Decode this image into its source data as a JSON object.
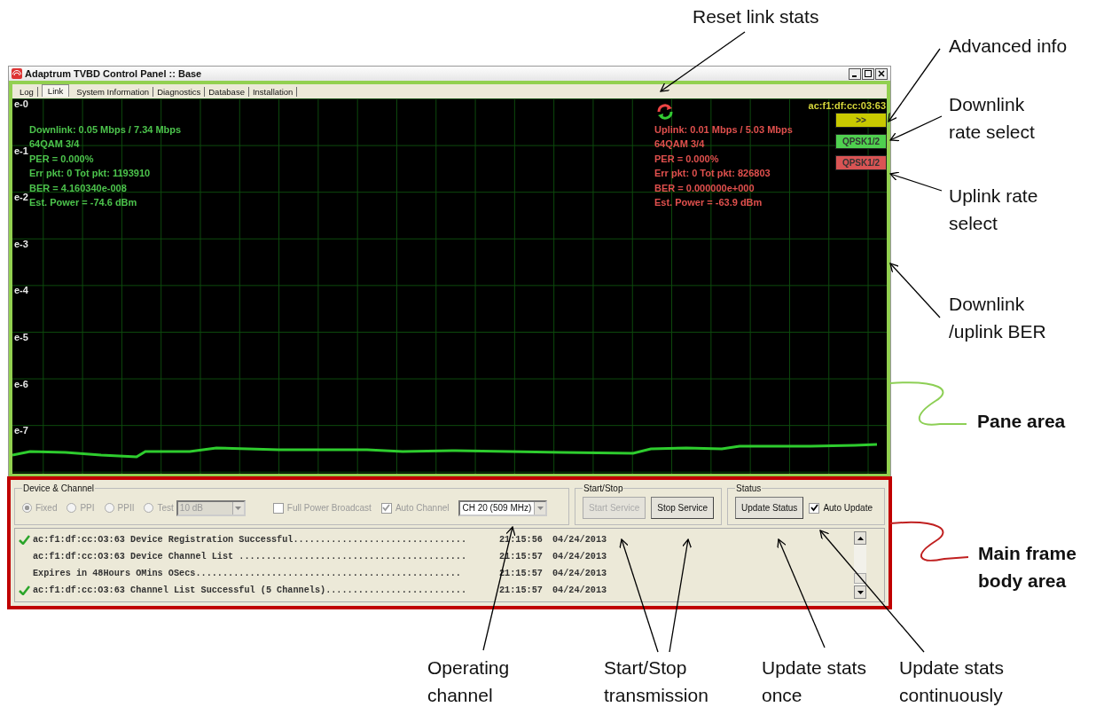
{
  "window": {
    "title": "Adaptrum TVBD Control Panel :: Base"
  },
  "tabs": [
    {
      "label": "Log",
      "selected": false
    },
    {
      "label": "Link",
      "selected": true
    },
    {
      "label": "System Information",
      "selected": false
    },
    {
      "label": "Diagnostics",
      "selected": false
    },
    {
      "label": "Database",
      "selected": false
    },
    {
      "label": "Installation",
      "selected": false
    }
  ],
  "plot": {
    "y_labels": [
      "e-0",
      "e-1",
      "e-2",
      "e-3",
      "e-4",
      "e-5",
      "e-6",
      "e-7"
    ],
    "device_id": "ac:f1:df:cc:03:63",
    "downlink_stats": [
      "Downlink:  0.05 Mbps / 7.34 Mbps",
      "64QAM  3/4",
      "PER = 0.000%",
      "Err pkt: 0 Tot pkt: 1193910",
      "BER = 4.160340e-008",
      "Est. Power = -74.6 dBm"
    ],
    "uplink_stats": [
      "Uplink: 0.01 Mbps / 5.03 Mbps",
      "64QAM  3/4",
      "PER = 0.000%",
      "Err pkt: 0 Tot pkt: 826803",
      "BER = 0.000000e+000",
      "Est. Power = -63.9 dBm"
    ],
    "advanced_button": ">>",
    "downlink_rate": "QPSK1/2",
    "uplink_rate": "QPSK1/2"
  },
  "device_channel": {
    "title": "Device & Channel",
    "modes": [
      {
        "label": "Fixed",
        "selected": true
      },
      {
        "label": "PPI",
        "selected": false
      },
      {
        "label": "PPII",
        "selected": false
      },
      {
        "label": "Test",
        "selected": false
      }
    ],
    "test_level": "10 dB",
    "full_power": {
      "label": "Full Power Broadcast",
      "checked": false
    },
    "auto_channel": {
      "label": "Auto Channel",
      "checked": true
    },
    "channel": "CH 20 (509 MHz)"
  },
  "start_stop": {
    "title": "Start/Stop",
    "buttons": [
      {
        "label": "Start Service",
        "disabled": true
      },
      {
        "label": "Stop Service",
        "disabled": false
      }
    ]
  },
  "status": {
    "title": "Status",
    "update_button": "Update Status",
    "auto_update": {
      "label": "Auto Update",
      "checked": true
    }
  },
  "log": [
    {
      "ok": true,
      "message": "ac:f1:df:cc:O3:63 Device Registration Successful................................",
      "time": "21:15:56",
      "date": "04/24/2013"
    },
    {
      "ok": false,
      "message": "ac:f1:df:cc:O3:63 Device Channel List ..........................................",
      "time": "21:15:57",
      "date": "04/24/2013"
    },
    {
      "ok": false,
      "message": "Expires in 48Hours OMins OSecs.................................................",
      "time": "21:15:57",
      "date": "04/24/2013"
    },
    {
      "ok": true,
      "message": "ac:f1:df:cc:O3:63 Channel List Successful (5 Channels)..........................",
      "time": "21:15:57",
      "date": "04/24/2013"
    }
  ],
  "annotations": [
    {
      "text": "Reset link stats",
      "bold": false
    },
    {
      "text": "Advanced info",
      "bold": false
    },
    {
      "text": "Downlink\nrate select",
      "bold": false
    },
    {
      "text": "Uplink rate\nselect",
      "bold": false
    },
    {
      "text": "Downlink\n/uplink BER",
      "bold": false
    },
    {
      "text": "Pane area",
      "bold": true
    },
    {
      "text": "Main frame\nbody area",
      "bold": true
    },
    {
      "text": "Operating\nchannel",
      "bold": false
    },
    {
      "text": "Start/Stop\ntransmission",
      "bold": false
    },
    {
      "text": "Update stats\nonce",
      "bold": false
    },
    {
      "text": "Update stats\ncontinuously",
      "bold": false
    }
  ]
}
